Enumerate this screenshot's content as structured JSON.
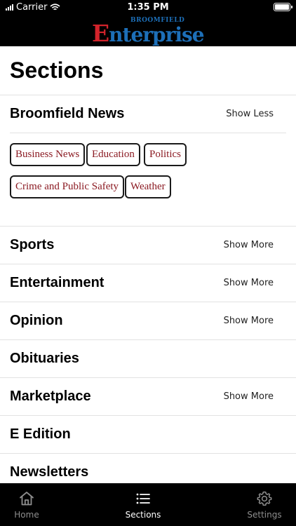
{
  "status_bar": {
    "carrier": "Carrier",
    "time": "1:35 PM"
  },
  "header": {
    "logo_small": "BROOMFIELD",
    "logo_first_letter": "E",
    "logo_rest": "nterprise"
  },
  "page": {
    "title": "Sections"
  },
  "sections": [
    {
      "name": "Broomfield News",
      "toggle": "Show Less",
      "subsections": [
        "Business News",
        "Education",
        "Politics",
        "Crime and Public Safety",
        "Weather"
      ]
    },
    {
      "name": "Sports",
      "toggle": "Show More"
    },
    {
      "name": "Entertainment",
      "toggle": "Show More"
    },
    {
      "name": "Opinion",
      "toggle": "Show More"
    },
    {
      "name": "Obituaries",
      "toggle": ""
    },
    {
      "name": "Marketplace",
      "toggle": "Show More"
    },
    {
      "name": "E Edition",
      "toggle": ""
    },
    {
      "name": "Newsletters",
      "toggle": ""
    }
  ],
  "tab_bar": {
    "tabs": [
      {
        "label": "Home",
        "icon": "home-icon",
        "active": false
      },
      {
        "label": "Sections",
        "icon": "list-icon",
        "active": true
      },
      {
        "label": "Settings",
        "icon": "gear-icon",
        "active": false
      }
    ]
  },
  "colors": {
    "header_bg": "#000000",
    "chip_text": "#8b1a22",
    "logo_blue": "#1d6fb8",
    "logo_red": "#d3232b"
  }
}
